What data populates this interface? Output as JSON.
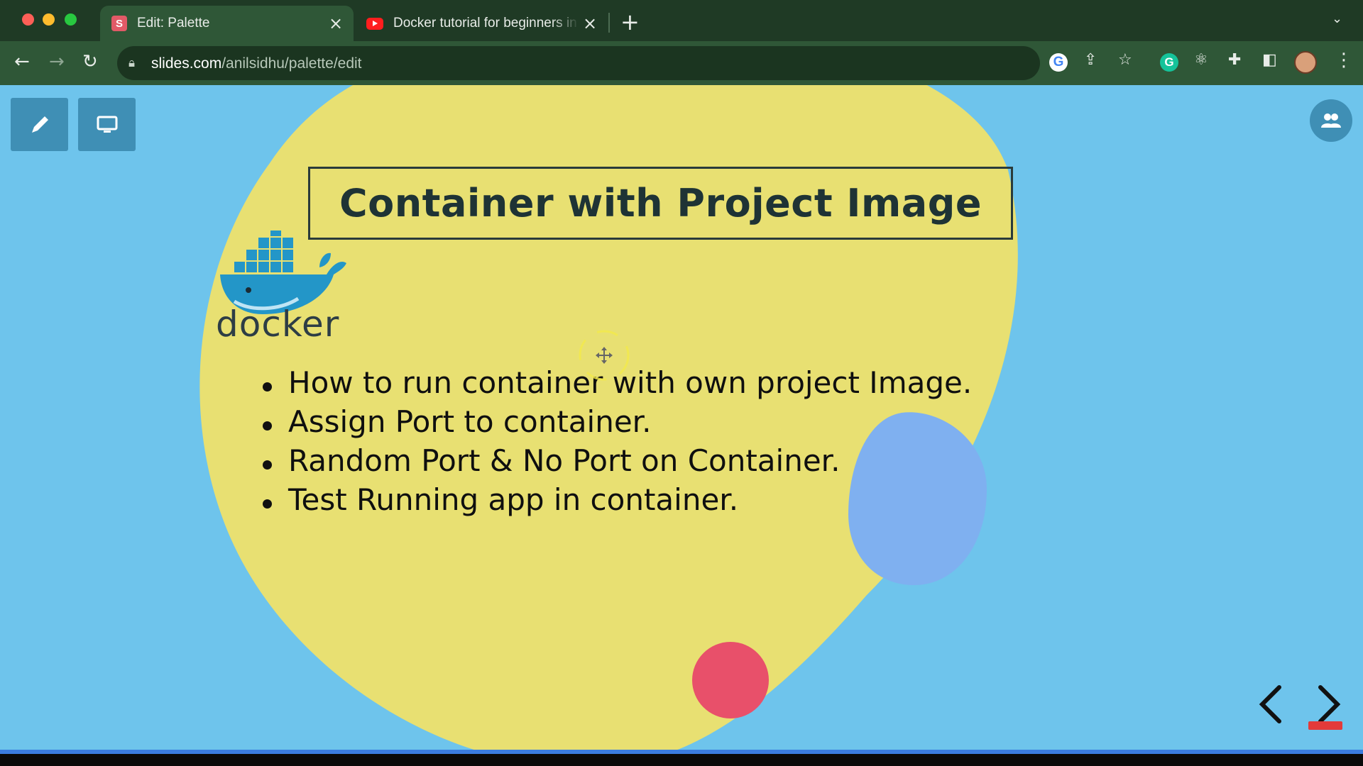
{
  "browser": {
    "tabs": [
      {
        "title": "Edit: Palette",
        "favicon": "S",
        "active": true
      },
      {
        "title": "Docker tutorial for beginners in",
        "favicon": "youtube-icon",
        "active": false
      }
    ],
    "url_host": "slides.com",
    "url_path": "/anilsidhu/palette/edit"
  },
  "slide": {
    "title": "Container with Project Image",
    "logo_text": "docker",
    "bullets": [
      "How to run container with own project Image.",
      "Assign Port to container.",
      "Random Port & No Port on Container.",
      "Test Running app in container."
    ]
  },
  "colors": {
    "background": "#6ec4ec",
    "blob_yellow": "#e8e072",
    "blob_blue": "#7fb0f0",
    "blob_red": "#e8506a",
    "docker_blue": "#2396c8"
  }
}
